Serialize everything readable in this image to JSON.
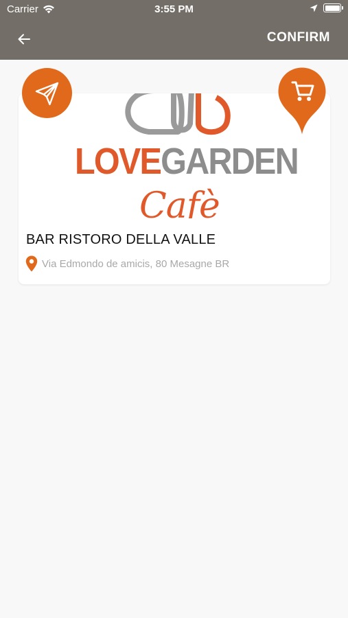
{
  "status": {
    "carrier": "Carrier",
    "time": "3:55 PM"
  },
  "nav": {
    "confirm_label": "CONFIRM"
  },
  "card": {
    "logo_love": "LOVE",
    "logo_garden": "GARDEN",
    "logo_script": "Cafè",
    "title": "BAR RISTORO DELLA VALLE",
    "address": "Via Edmondo de amicis, 80 Mesagne BR"
  },
  "colors": {
    "topbar": "#736e67",
    "accent": "#e0691b",
    "logo_orange": "#e0592b",
    "logo_gray": "#8d8d8d",
    "background": "#f8f8f8"
  },
  "icons": {
    "back": "arrow-left-icon",
    "send": "paper-plane-icon",
    "cart": "shopping-cart-icon",
    "location": "location-pin-icon"
  }
}
